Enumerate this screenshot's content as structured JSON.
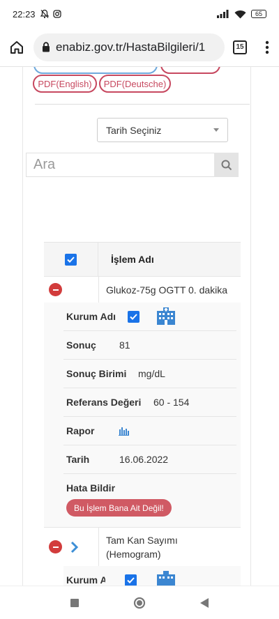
{
  "status": {
    "time": "22:23",
    "battery": "65"
  },
  "browser": {
    "url": "enabiz.gov.tr/HastaBilgileri/1",
    "tab_count": "15"
  },
  "pdf_buttons": {
    "english": "PDF(English)",
    "deutsche": "PDF(Deutsche)"
  },
  "date_select": {
    "label": "Tarih Seçiniz"
  },
  "search": {
    "placeholder": "Ara"
  },
  "table": {
    "header": "İşlem Adı",
    "rows": [
      {
        "name": "Glukoz-75g OGTT 0. dakika",
        "labels": {
          "institution": "Kurum Adı",
          "result": "Sonuç",
          "unit": "Sonuç Birimi",
          "reference": "Referans Değeri",
          "report": "Rapor",
          "date": "Tarih",
          "report_error": "Hata Bildir"
        },
        "values": {
          "result": "81",
          "unit": "mg/dL",
          "reference": "60 - 154",
          "date": "16.06.2022"
        },
        "error_button": "Bu İşlem Bana Ait Değil!"
      },
      {
        "name_line1": "Tam Kan Sayımı",
        "name_line2": "(Hemogram)",
        "partial_label": "Kurum Adı"
      }
    ]
  },
  "colors": {
    "accent_red": "#c7485f",
    "check_blue": "#1a73e8",
    "minus_red": "#d23c3c",
    "chevron_blue": "#3d8fd6"
  }
}
